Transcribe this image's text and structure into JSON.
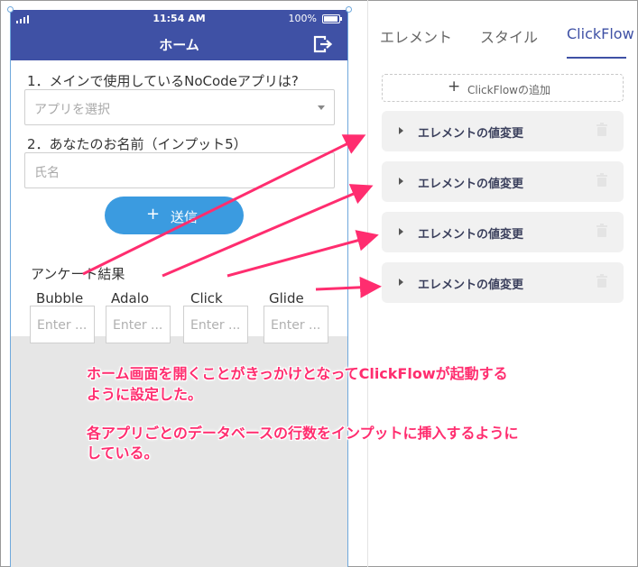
{
  "status_bar": {
    "time": "11:54 AM",
    "battery_pct": "100%"
  },
  "app_bar": {
    "title": "ホーム"
  },
  "form": {
    "q1": "1．メインで使用しているNoCodeアプリは?",
    "q1_placeholder": "アプリを選択",
    "q2": "2．あなたのお名前（インプット5）",
    "q2_placeholder": "氏名",
    "send_label": "送信",
    "send_icon": "plus-icon",
    "survey_label": "アンケート結果",
    "apps": [
      {
        "label": "Bubble",
        "placeholder": "Enter ..."
      },
      {
        "label": "Adalo",
        "placeholder": "Enter ..."
      },
      {
        "label": "Click",
        "placeholder": "Enter ..."
      },
      {
        "label": "Glide",
        "placeholder": "Enter ..."
      }
    ]
  },
  "panel": {
    "tabs": [
      {
        "label": "エレメント",
        "active": false
      },
      {
        "label": "スタイル",
        "active": false
      },
      {
        "label": "ClickFlow",
        "active": true
      }
    ],
    "add_flow_label": "ClickFlowの追加",
    "flows": [
      {
        "label": "エレメントの値変更"
      },
      {
        "label": "エレメントの値変更"
      },
      {
        "label": "エレメントの値変更"
      },
      {
        "label": "エレメントの値変更"
      }
    ]
  },
  "annotations": {
    "line1": "ホーム画面を開くことがきっかけとなってClickFlowが起動する",
    "line2": "ように設定した。",
    "line3": "各アプリごとのデータベースの行数をインプットに挿入するように",
    "line4": "している。"
  },
  "colors": {
    "primary": "#3f51a5",
    "button": "#3b9be0",
    "annotation": "#ff2d6f"
  }
}
